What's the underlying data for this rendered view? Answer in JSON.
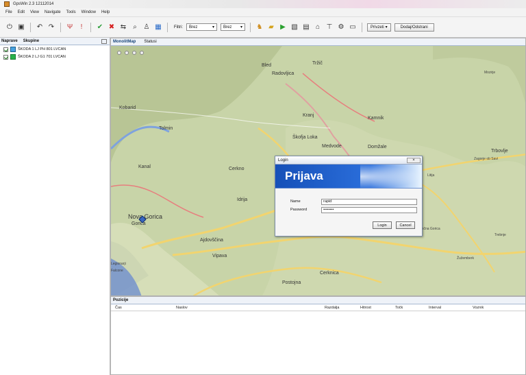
{
  "window": {
    "title": "GpsWin 2.3 12112014"
  },
  "menu": [
    "File",
    "Edit",
    "View",
    "Navigate",
    "Tools",
    "Window",
    "Help"
  ],
  "toolbar": {
    "filter_label": "Filtri:",
    "filter1": "Brez",
    "filter2": "Brez",
    "privzeti": "Privzeti",
    "dodaj": "Dodaj/Odstrani"
  },
  "left_panel": {
    "tabs": [
      "Naprave",
      "Skupine"
    ],
    "devices": [
      "ŠKODA 1 LJ PH 801 LVCAN",
      "ŠKODA 2 LJ G1 701 LVCAN"
    ]
  },
  "map": {
    "tabs": [
      "MonolitMap",
      "Statusi"
    ],
    "places": [
      {
        "name": "Bled",
        "size": "mid"
      },
      {
        "name": "Radovljica",
        "size": "mid"
      },
      {
        "name": "Tržič",
        "size": "mid"
      },
      {
        "name": "Kranj",
        "size": "mid"
      },
      {
        "name": "Kamnik",
        "size": "mid"
      },
      {
        "name": "Domžale",
        "size": "mid"
      },
      {
        "name": "Škofja Loka",
        "size": "mid"
      },
      {
        "name": "Medvode",
        "size": "mid"
      },
      {
        "name": "Tolmin",
        "size": "mid"
      },
      {
        "name": "Kobarid",
        "size": "mid"
      },
      {
        "name": "Kanal",
        "size": "mid"
      },
      {
        "name": "Cerkno",
        "size": "mid"
      },
      {
        "name": "Idrija",
        "size": "mid"
      },
      {
        "name": "Nova Gorica",
        "size": "big"
      },
      {
        "name": "Gorica",
        "size": "mid"
      },
      {
        "name": "Ajdovščina",
        "size": "mid"
      },
      {
        "name": "Vipava",
        "size": "mid"
      },
      {
        "name": "Postojna",
        "size": "mid"
      },
      {
        "name": "Cerknica",
        "size": "mid"
      },
      {
        "name": "Trbovlje",
        "size": "mid"
      },
      {
        "name": "Zagorje ob Savi",
        "size": "small"
      },
      {
        "name": "Litija",
        "size": "small"
      },
      {
        "name": "Ivančna Gorica",
        "size": "small"
      },
      {
        "name": "Žužemberk",
        "size": "small"
      },
      {
        "name": "Trebnje",
        "size": "small"
      },
      {
        "name": "Mozirje",
        "size": "small"
      },
      {
        "name": "Legionarji",
        "size": "small"
      },
      {
        "name": "Falcone",
        "size": "small"
      }
    ]
  },
  "positions": {
    "tab": "Pozicije",
    "headers": [
      "Čas",
      "Naslov",
      "Razdalja",
      "Hitrost",
      "Točk",
      "Interval",
      "Voznik"
    ]
  },
  "login_dialog": {
    "title": "Login",
    "heading": "Prijava",
    "name_label": "Name",
    "name_value": "rapid",
    "password_label": "Password",
    "password_value": "••••••••",
    "login_button": "Login",
    "cancel_button": "Cancel"
  }
}
